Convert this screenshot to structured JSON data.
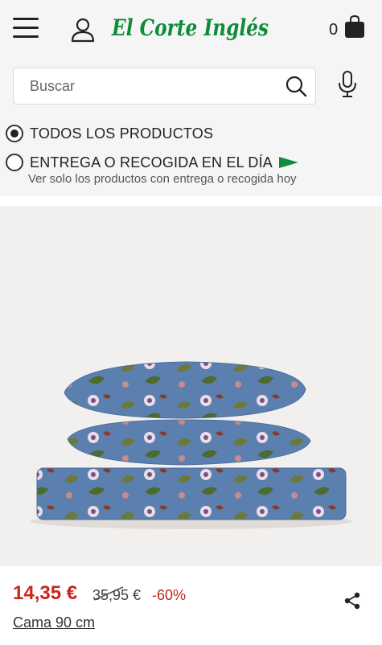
{
  "header": {
    "logo_text": "El Corte Inglés",
    "cart_count": "0",
    "brand_color": "#0f8c3b"
  },
  "search": {
    "placeholder": "Buscar"
  },
  "filters": {
    "options": [
      {
        "label": "TODOS LOS PRODUCTOS",
        "checked": true
      },
      {
        "label": "ENTREGA O RECOGIDA EN EL DÍA",
        "checked": false
      }
    ],
    "subtitle": "Ver solo los productos con entrega o recogida hoy",
    "flag_color": "#0f8c3b"
  },
  "product": {
    "price_now": "14,35 €",
    "price_old": "35,95 €",
    "discount": "-60%",
    "size": "Cama 90 cm",
    "price_color": "#c8261d"
  },
  "icons": [
    "menu-icon",
    "user-icon",
    "bag-icon",
    "search-icon",
    "mic-icon",
    "flag-icon",
    "share-icon"
  ]
}
